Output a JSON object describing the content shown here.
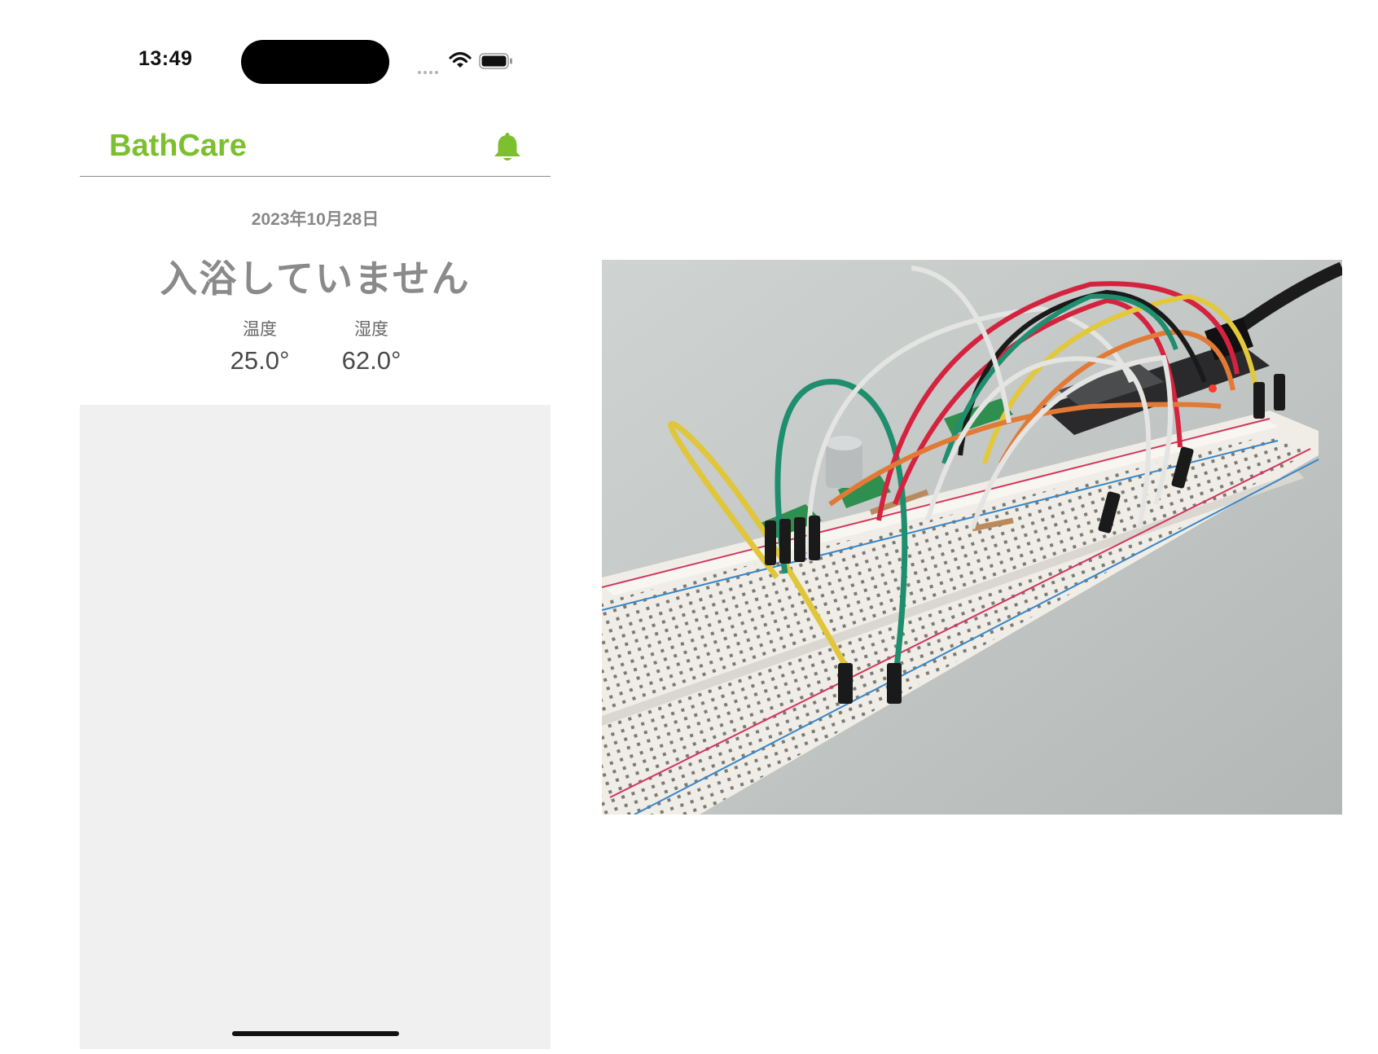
{
  "status_bar": {
    "time": "13:49",
    "icons": [
      "signal-dots-icon",
      "wifi-icon",
      "battery-icon"
    ]
  },
  "header": {
    "app_title": "BathCare",
    "notification_icon": "bell-icon",
    "accent_color": "#7cbf2f"
  },
  "main": {
    "date": "2023年10月28日",
    "bath_status": "入浴していません",
    "readings": [
      {
        "label": "温度",
        "value": "25.0°"
      },
      {
        "label": "湿度",
        "value": "62.0°"
      }
    ]
  },
  "photo": {
    "subject": "breadboard-prototype-photo"
  }
}
